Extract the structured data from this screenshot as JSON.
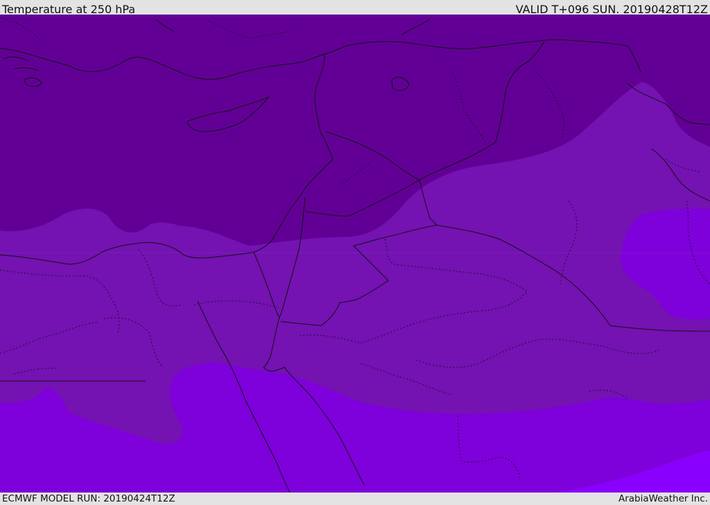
{
  "header": {
    "title": "Temperature at 250 hPa",
    "valid_time": "VALID T+096 SUN. 20190428T12Z"
  },
  "footer": {
    "model_run": "ECMWF MODEL RUN: 20190424T12Z",
    "credit": "ArabiaWeather Inc."
  },
  "map": {
    "variable": "temperature",
    "level": "250 hPa",
    "colors": {
      "coldest": "#620096",
      "cold": "#7412b2",
      "mild": "#7e00da",
      "warm": "#8a00ff",
      "boundary": "#000000"
    }
  }
}
